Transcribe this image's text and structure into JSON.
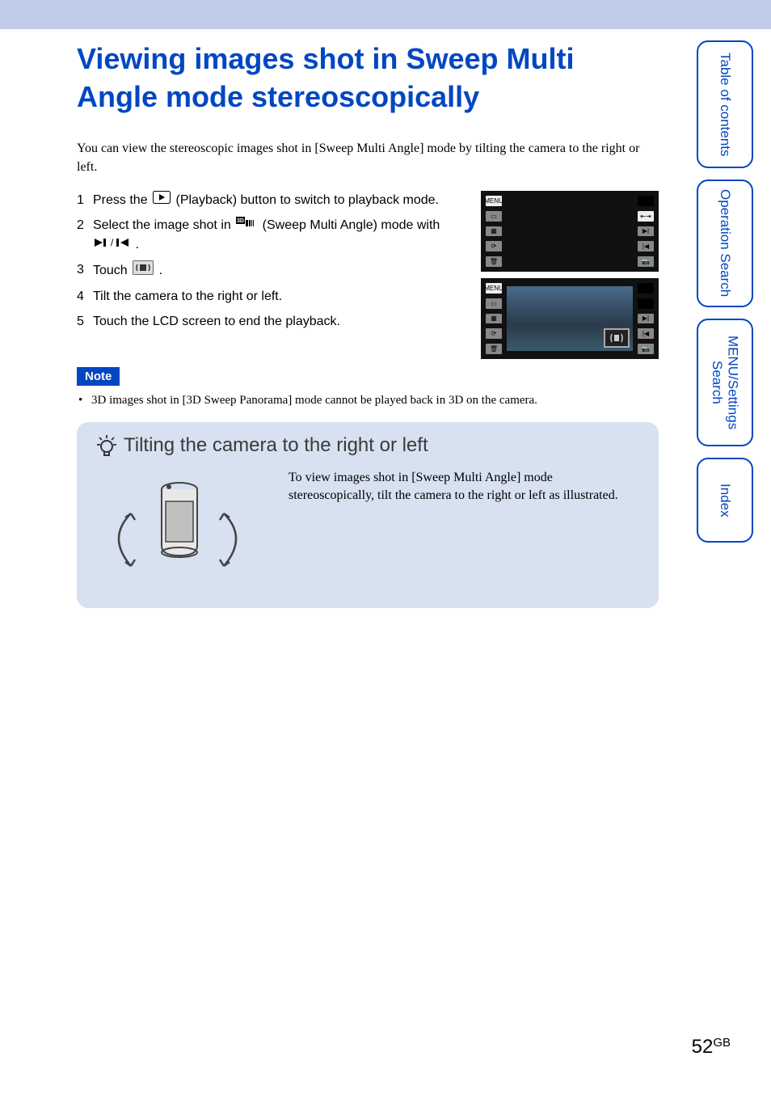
{
  "title": "Viewing images shot in Sweep Multi Angle mode stereoscopically",
  "intro": "You can view the stereoscopic images shot in [Sweep Multi Angle] mode by tilting the camera to the right or left.",
  "steps": [
    {
      "num": "1",
      "before": "Press the ",
      "after": " (Playback) button to switch to playback mode.",
      "icon": "playback"
    },
    {
      "num": "2",
      "before": "Select the image shot in ",
      "mid": " (Sweep Multi Angle) mode with ",
      "after": ".",
      "icon": "3d-multi",
      "icon2": "next-prev"
    },
    {
      "num": "3",
      "before": "Touch ",
      "after": ".",
      "icon": "scroll-play"
    },
    {
      "num": "4",
      "before": "Tilt the camera to the right or left.",
      "after": ""
    },
    {
      "num": "5",
      "before": "Touch the LCD screen to end the playback.",
      "after": ""
    }
  ],
  "note_label": "Note",
  "note_text": "3D images shot in [3D Sweep Panorama] mode cannot be played back in 3D on the camera.",
  "tip": {
    "title": "Tilting the camera to the right or left",
    "text": "To view images shot in [Sweep Multi Angle] mode stereoscopically, tilt the camera to the right or left as illustrated."
  },
  "sidetabs": [
    "Table of contents",
    "Operation Search",
    "MENU/Settings Search",
    "Index"
  ],
  "page_number": "52",
  "page_suffix": "GB",
  "screenshot_menu": "MENU"
}
